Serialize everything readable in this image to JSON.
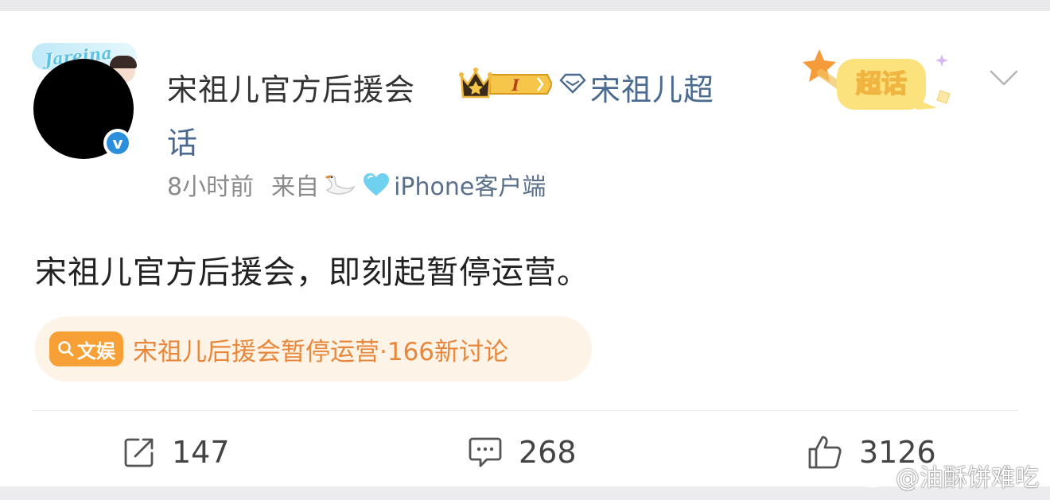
{
  "post": {
    "author_name": "宋祖儿官方后援会",
    "fan_level": "I",
    "supertopic_link_line1": "宋祖儿超",
    "supertopic_link_line2": "话",
    "time": "8小时前",
    "source_prefix": "来自",
    "device": "iPhone客户端",
    "supertopic_sticker": "超话",
    "avatar_frame_text": "Jareina",
    "content": "宋祖儿官方后援会，即刻起暂停运营。",
    "topic_tag": "文娱",
    "topic_text": "宋祖儿后援会暂停运营·166新讨论"
  },
  "actions": {
    "repost_count": "147",
    "comment_count": "268",
    "like_count": "3126"
  },
  "watermark": {
    "text": "@油酥饼难吃"
  },
  "colors": {
    "link_blue": "#4b6a8f",
    "topic_orange": "#e8873a",
    "topic_tag_bg": "#f7a036",
    "verified_blue": "#2b8fdc"
  },
  "icons": [
    "verified-icon",
    "crown-icon",
    "diamond-icon",
    "swan-icon",
    "heart-icon",
    "chevron-down-icon",
    "repost-icon",
    "comment-icon",
    "like-icon",
    "weibo-logo-icon",
    "search-icon"
  ]
}
